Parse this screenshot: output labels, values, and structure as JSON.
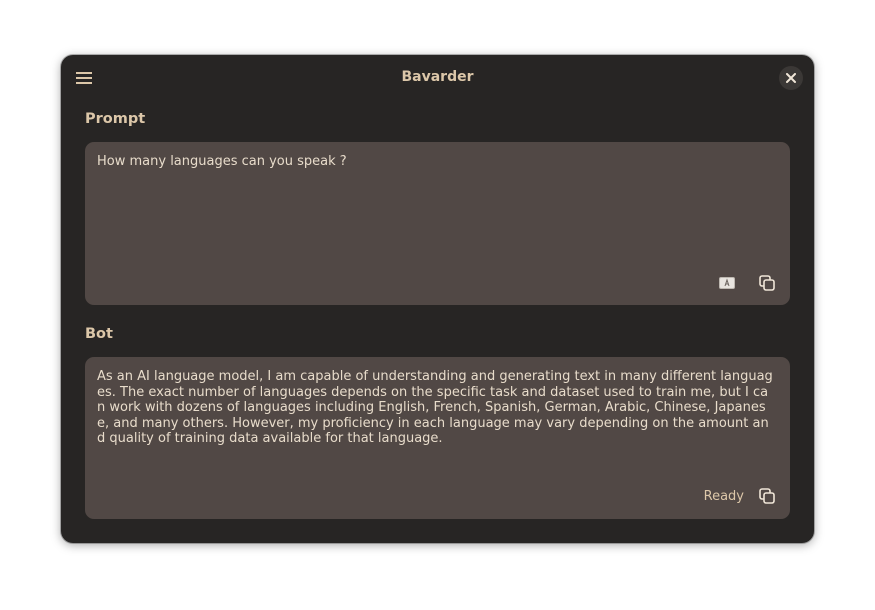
{
  "window": {
    "title": "Bavarder"
  },
  "prompt": {
    "label": "Prompt",
    "text": "How many languages can you speak ?"
  },
  "bot": {
    "label": "Bot",
    "text": "As an AI language model, I am capable of understanding and generating text in many different languages. The exact number of languages depends on the specific task and dataset used to train me, but I can work with dozens of languages including English, French, Spanish, German, Arabic, Chinese, Japanese, and many others. However, my proficiency in each language may vary depending on the amount and quality of training data available for that language.",
    "status": "Ready"
  },
  "icons": {
    "menu": "hamburger-menu-icon",
    "close": "close-icon",
    "speak": "speak-icon",
    "copy": "copy-icon"
  },
  "colors": {
    "window_bg": "#272524",
    "box_bg": "#514845",
    "accent_text": "#dcc7a9",
    "body_text": "#e8dccb"
  }
}
